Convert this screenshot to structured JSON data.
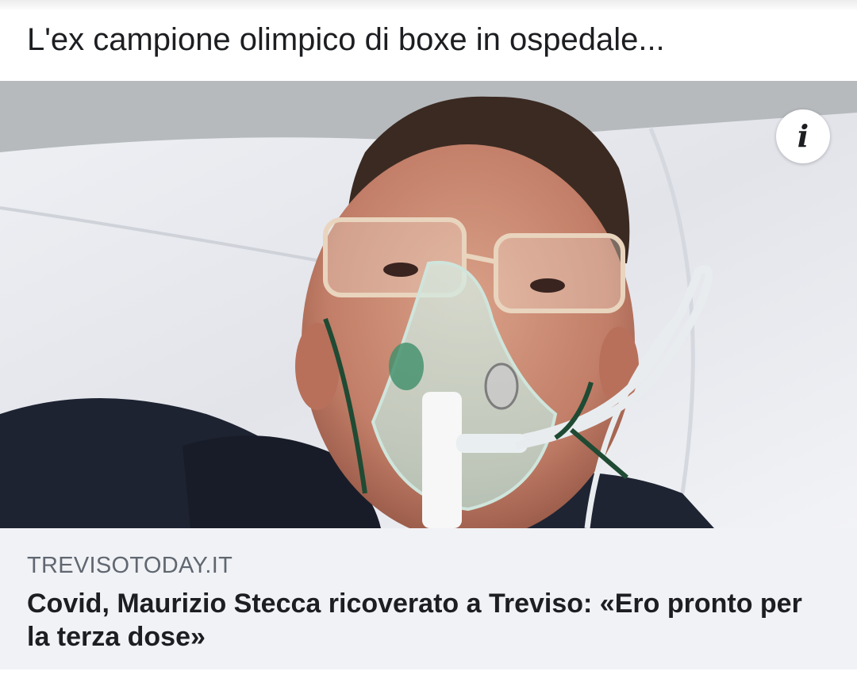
{
  "post": {
    "text": "L'ex campione olimpico di boxe in ospedale..."
  },
  "image": {
    "icons": [
      "info-icon"
    ],
    "info_glyph": "i"
  },
  "link_preview": {
    "domain": "TREVISOTODAY.IT",
    "title": "Covid, Maurizio Stecca ricoverato a Treviso: «Ero pronto per la terza dose»"
  },
  "colors": {
    "text": "#1c1e21",
    "domain": "#606770",
    "card_background": "#f1f2f6"
  }
}
